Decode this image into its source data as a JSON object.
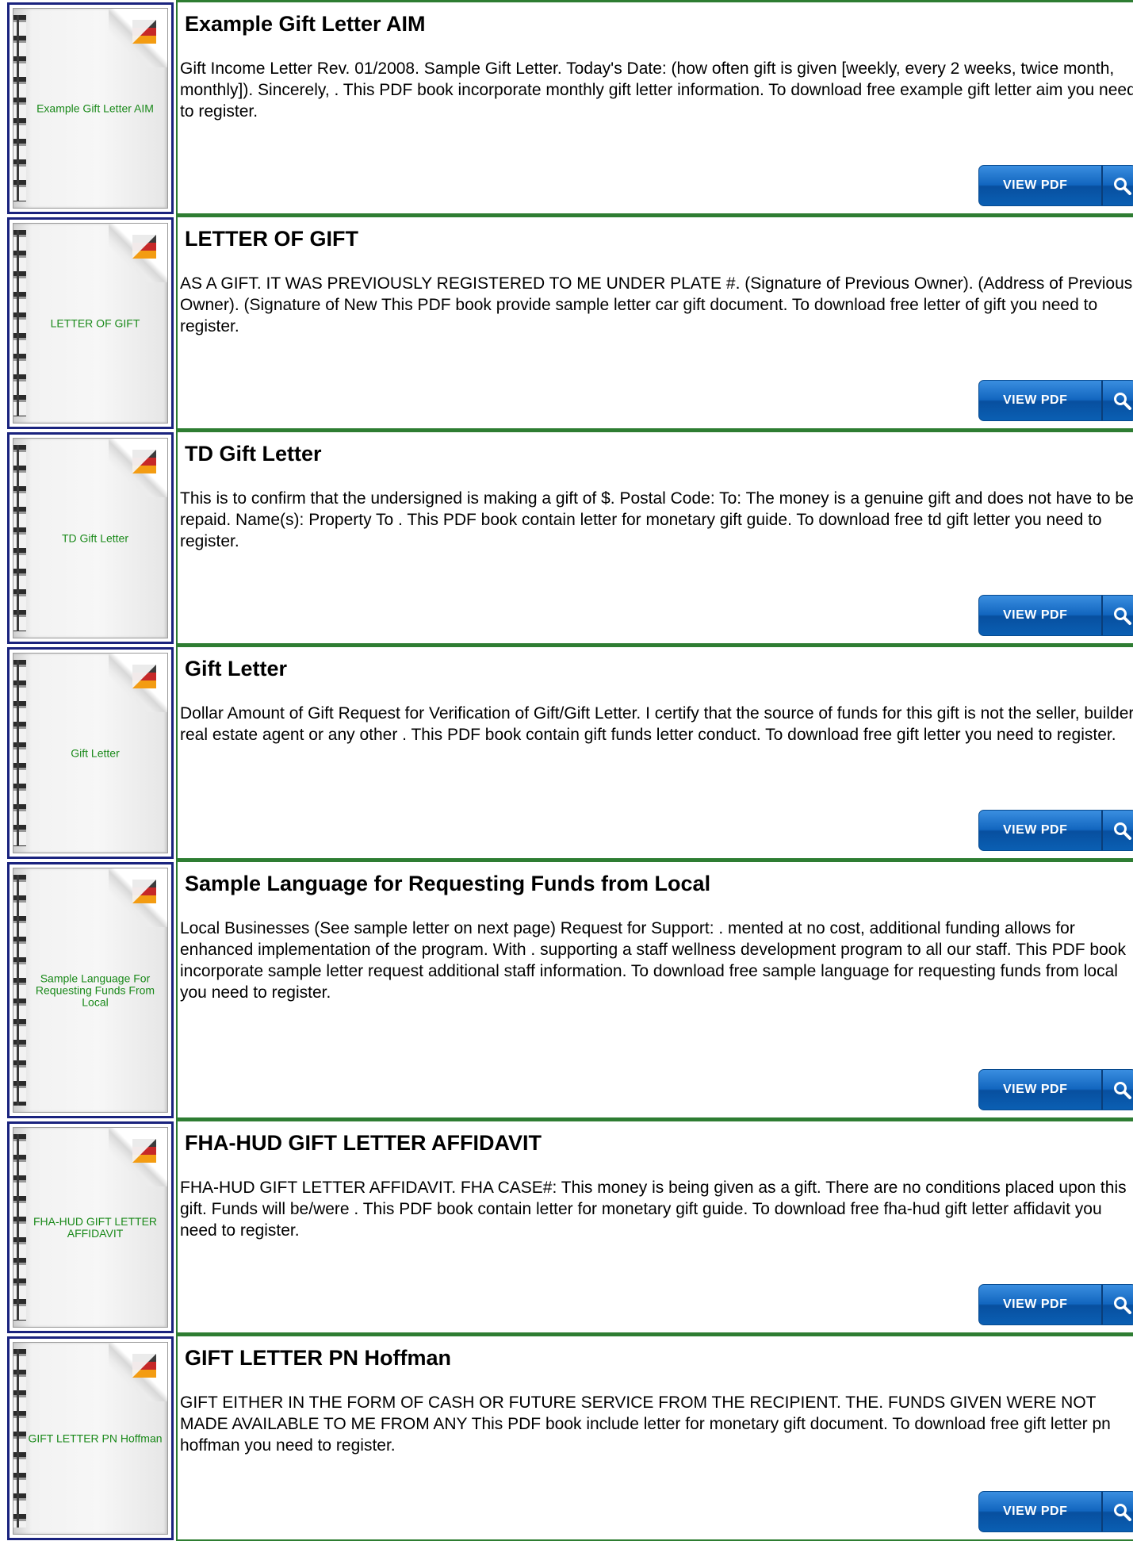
{
  "books": [
    {
      "title": "Example Gift Letter AIM",
      "cover_label": "Example Gift Letter AIM",
      "description": "Gift Income Letter Rev. 01/2008. Sample Gift Letter. Today's Date: (how often gift is given [weekly, every 2 weeks, twice month, monthly]). Sincerely, . This PDF book incorporate monthly gift letter information. To download free example gift letter aim you need to register.",
      "button_label": "VIEW PDF",
      "button_icon": "search-icon"
    },
    {
      "title": "LETTER OF GIFT",
      "cover_label": "LETTER OF GIFT",
      "description": "AS A GIFT. IT WAS PREVIOUSLY REGISTERED TO ME UNDER PLATE #. (Signature of Previous Owner). (Address of Previous Owner). (Signature of New  This PDF book provide sample letter car gift document. To download free letter of gift you need to register.",
      "button_label": "VIEW PDF",
      "button_icon": "search-icon"
    },
    {
      "title": "TD Gift Letter",
      "cover_label": "TD Gift Letter",
      "description": "This is to confirm that the undersigned is making a gift of $. Postal Code: To: The money is a genuine gift and does not have to be repaid. Name(s): Property To . This PDF book contain letter for monetary gift guide. To download free td gift letter you need to register.",
      "button_label": "VIEW PDF",
      "button_icon": "search-icon"
    },
    {
      "title": "Gift Letter",
      "cover_label": "Gift Letter",
      "description": "Dollar Amount of Gift Request for Verification of Gift/Gift Letter. I certify that the source of funds for this gift is not the seller, builder, real estate agent or any other . This PDF book contain gift funds letter conduct. To download free gift letter you need to register.",
      "button_label": "VIEW PDF",
      "button_icon": "search-icon"
    },
    {
      "title": "Sample Language for Requesting Funds from Local",
      "cover_label": "Sample Language For Requesting Funds From Local",
      "description": "Local Businesses (See sample letter on next page) Request for Support: . mented at no cost, additional funding allows for enhanced implementation of the program. With . supporting a staff wellness development program to all our staff. This PDF book incorporate sample letter request additional staff information. To download free sample language for requesting funds from local you need to register.",
      "button_label": "VIEW PDF",
      "button_icon": "search-icon"
    },
    {
      "title": "FHA-HUD GIFT LETTER AFFIDAVIT",
      "cover_label": "FHA-HUD GIFT LETTER AFFIDAVIT",
      "description": "FHA-HUD GIFT LETTER AFFIDAVIT. FHA CASE#: This money is being given as a gift. There are no conditions placed upon this gift. Funds will be/were . This PDF book contain letter for monetary gift guide. To download free fha-hud gift letter affidavit you need to register.",
      "button_label": "VIEW PDF",
      "button_icon": "search-icon"
    },
    {
      "title": "GIFT LETTER PN Hoffman",
      "cover_label": "GIFT LETTER PN Hoffman",
      "description": "GIFT EITHER IN THE FORM OF CASH OR FUTURE SERVICE FROM THE RECIPIENT. THE. FUNDS GIVEN WERE NOT MADE AVAILABLE TO ME FROM ANY  This PDF book include letter for monetary gift document. To download free gift letter pn hoffman you need to register.",
      "button_label": "VIEW PDF",
      "button_icon": "search-icon"
    }
  ],
  "colors": {
    "thumb_border": "#1a237e",
    "row_border": "#2e7d32",
    "cover_label": "#1b8a1b",
    "button": "#0d5cb6"
  }
}
